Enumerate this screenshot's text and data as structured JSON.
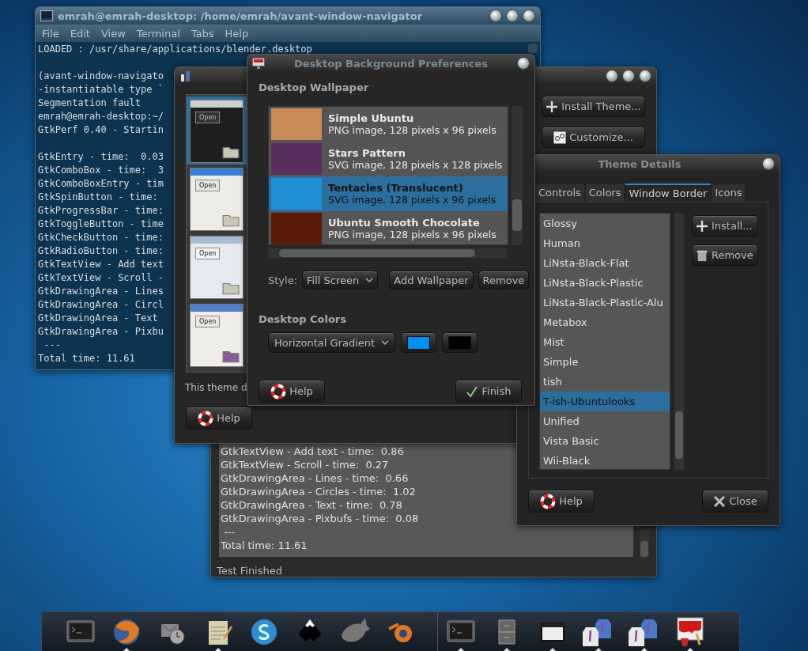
{
  "terminal": {
    "title": "emrah@emrah-desktop: /home/emrah/avant-window-navigator",
    "menu": [
      "File",
      "Edit",
      "View",
      "Terminal",
      "Tabs",
      "Help"
    ],
    "blocks": [
      [
        "LOADED : /usr/share/applications/blender.desktop"
      ],
      [
        "(avant-window-navigato",
        "-instantiatable type `",
        "Segmentation fault",
        "emrah@emrah-desktop:~/",
        "GtkPerf 0.40 - Startin"
      ],
      [
        "GtkEntry - time:  0.03",
        "GtkComboBox - time:  3",
        "GtkComboBoxEntry - tim",
        "GtkSpinButton - time:",
        "GtkProgressBar - time:",
        "GtkToggleButton - time",
        "GtkCheckButton - time:",
        "GtkRadioButton - time:",
        "GtkTextView - Add text",
        "GtkTextView - Scroll -",
        "GtkDrawingArea - Lines",
        "GtkDrawingArea - Circl",
        "GtkDrawingArea - Text",
        "GtkDrawingArea - Pixbu",
        " ---",
        "Total time: 11.61"
      ]
    ]
  },
  "gtkperf": {
    "lines": [
      "GtkTextView - Add text - time:  0.86",
      "GtkTextView - Scroll - time:  0.27",
      "GtkDrawingArea - Lines - time:  0.66",
      "GtkDrawingArea - Circles - time:  1.02",
      "GtkDrawingArea - Text - time:  0.78",
      "GtkDrawingArea - Pixbufs - time:  0.08",
      " ---",
      "Total time: 11.61"
    ],
    "status": "Test Finished"
  },
  "appearance": {
    "previews": [
      {
        "kind": "dark",
        "label": "Open",
        "selected": true
      },
      {
        "kind": "blue",
        "label": "Open",
        "selected": false
      },
      {
        "kind": "light",
        "label": "Open",
        "selected": false
      },
      {
        "kind": "classic",
        "label": "Open",
        "selected": false
      }
    ],
    "install_button": "Install Theme...",
    "customize_button": "Customize...",
    "description": "This theme d",
    "help_button": "Help"
  },
  "theme_details": {
    "title": "Theme Details",
    "tabs": [
      {
        "label": "Controls",
        "selected": false
      },
      {
        "label": "Colors",
        "selected": false
      },
      {
        "label": "Window Border",
        "selected": true
      },
      {
        "label": "Icons",
        "selected": false
      }
    ],
    "items": [
      {
        "label": "Glossy",
        "selected": false
      },
      {
        "label": "Human",
        "selected": false
      },
      {
        "label": "LiNsta-Black-Flat",
        "selected": false
      },
      {
        "label": "LiNsta-Black-Plastic",
        "selected": false
      },
      {
        "label": "LiNsta-Black-Plastic-Alu",
        "selected": false
      },
      {
        "label": "Metabox",
        "selected": false
      },
      {
        "label": "Mist",
        "selected": false
      },
      {
        "label": "Simple",
        "selected": false
      },
      {
        "label": "tish",
        "selected": false
      },
      {
        "label": "T-ish-Ubuntulooks",
        "selected": true
      },
      {
        "label": "Unified",
        "selected": false
      },
      {
        "label": "Vista Basic",
        "selected": false
      },
      {
        "label": "Wii-Black",
        "selected": false
      }
    ],
    "install_button": "Install...",
    "remove_button": "Remove",
    "help_button": "Help",
    "close_button": "Close"
  },
  "background": {
    "title": "Desktop Background Preferences",
    "wallpaper_heading": "Desktop Wallpaper",
    "wallpapers": [
      {
        "name": "Simple Ubuntu",
        "info": "PNG image, 128 pixels x 96 pixels",
        "color": "#c98a58",
        "selected": false
      },
      {
        "name": "Stars Pattern",
        "info": "SVG image, 128 pixels x 128 pixels",
        "color": "#5a2e5e",
        "selected": false
      },
      {
        "name": "Tentacles (Translucent)",
        "info": "SVG image, 128 pixels x 96 pixels",
        "color": "#1f8fd8",
        "selected": true
      },
      {
        "name": "Ubuntu Smooth Chocolate",
        "info": "PNG image, 128 pixels x 96 pixels",
        "color": "#5a1a08",
        "selected": false
      }
    ],
    "style_label": "Style:",
    "style_value": "Fill Screen",
    "add_button": "Add Wallpaper",
    "remove_button": "Remove",
    "colors_heading": "Desktop Colors",
    "color_mode": "Horizontal Gradient",
    "colors": [
      {
        "color": "#0090f0"
      },
      {
        "color": "#000000"
      }
    ],
    "help_button": "Help",
    "finish_button": "Finish"
  },
  "dock": {
    "launchers": [
      {
        "kind": "terminal",
        "running": false
      },
      {
        "kind": "browser",
        "running": true
      },
      {
        "kind": "mail-clock",
        "running": false
      },
      {
        "kind": "notepad",
        "running": true
      },
      {
        "kind": "chat",
        "running": false
      },
      {
        "kind": "ink",
        "running": false
      },
      {
        "kind": "animal",
        "running": false
      },
      {
        "kind": "orbit",
        "running": false
      }
    ],
    "tasks": [
      {
        "kind": "terminal",
        "running": true
      },
      {
        "kind": "cabinet",
        "running": true
      },
      {
        "kind": "window",
        "running": true
      },
      {
        "kind": "shirts",
        "running": true
      },
      {
        "kind": "shirts",
        "running": true
      },
      {
        "kind": "paint",
        "running": true
      }
    ]
  }
}
